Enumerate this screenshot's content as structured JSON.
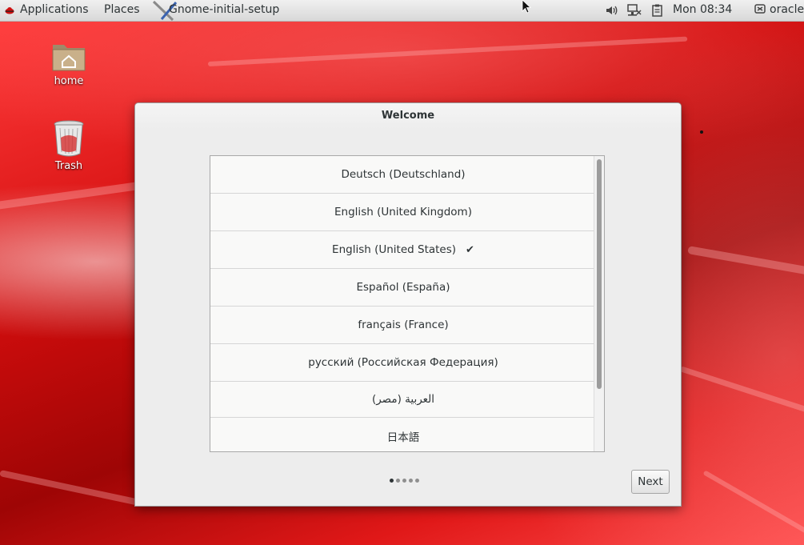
{
  "panel": {
    "applications": "Applications",
    "places": "Places",
    "window_title": "Gnome-initial-setup",
    "clock": "Mon 08:34",
    "user": "oracle"
  },
  "desktop": {
    "icons": [
      {
        "label": "home",
        "icon": "home-folder-icon"
      },
      {
        "label": "Trash",
        "icon": "trash-icon"
      }
    ]
  },
  "dialog": {
    "title": "Welcome",
    "languages": [
      {
        "label": "Deutsch (Deutschland)",
        "selected": false
      },
      {
        "label": "English (United Kingdom)",
        "selected": false
      },
      {
        "label": "English (United States)",
        "selected": true
      },
      {
        "label": "Español (España)",
        "selected": false
      },
      {
        "label": "français (France)",
        "selected": false
      },
      {
        "label": "русский (Российская Федерация)",
        "selected": false
      },
      {
        "label": "العربية (مصر)",
        "selected": false
      },
      {
        "label": "日本語",
        "selected": false
      }
    ],
    "check_mark": "✔",
    "pages_total": 5,
    "current_page": 1,
    "next_label": "Next"
  },
  "colors": {
    "desktop_red": "#d10d0d",
    "panel_bg": "#e4e4e4",
    "dialog_bg": "#ededed"
  }
}
